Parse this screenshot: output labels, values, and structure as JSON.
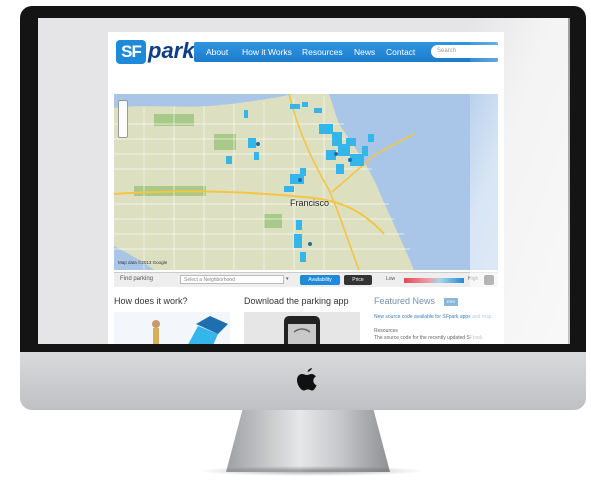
{
  "site": {
    "logo_badge": "SF",
    "logo_word": "park",
    "nav": [
      {
        "label": "About"
      },
      {
        "label": "How it Works"
      },
      {
        "label": "Resources"
      },
      {
        "label": "News"
      },
      {
        "label": "Contact"
      }
    ],
    "search_placeholder": "Search"
  },
  "map": {
    "city_label": "Francisco",
    "attribution": "Map data ©2013 Google"
  },
  "toolbar": {
    "find_parking": "Find parking",
    "neighborhood_placeholder": "Select a Neighborhood",
    "availability_label": "Availability",
    "price_label": "Price",
    "low_label": "Low",
    "high_label": "High"
  },
  "sections": {
    "how_title": "How does it work?",
    "app_title": "Download the parking app",
    "news_title": "Featured News",
    "news_rss": "RSS",
    "news_line_1": "New source code available for SFpark apps and map.",
    "news_line_2": "Resources",
    "news_line_3": "The source code for the recently updated SFpark"
  },
  "colors": {
    "brand_blue": "#1f8ad8",
    "nav_blue": "#2f95e1",
    "logo_navy": "#0e3f86",
    "parking_cyan": "#35b6ea",
    "price_red": "#e44856"
  },
  "icons": {
    "device_logo": "apple-logo-icon",
    "refresh": "refresh-icon"
  }
}
